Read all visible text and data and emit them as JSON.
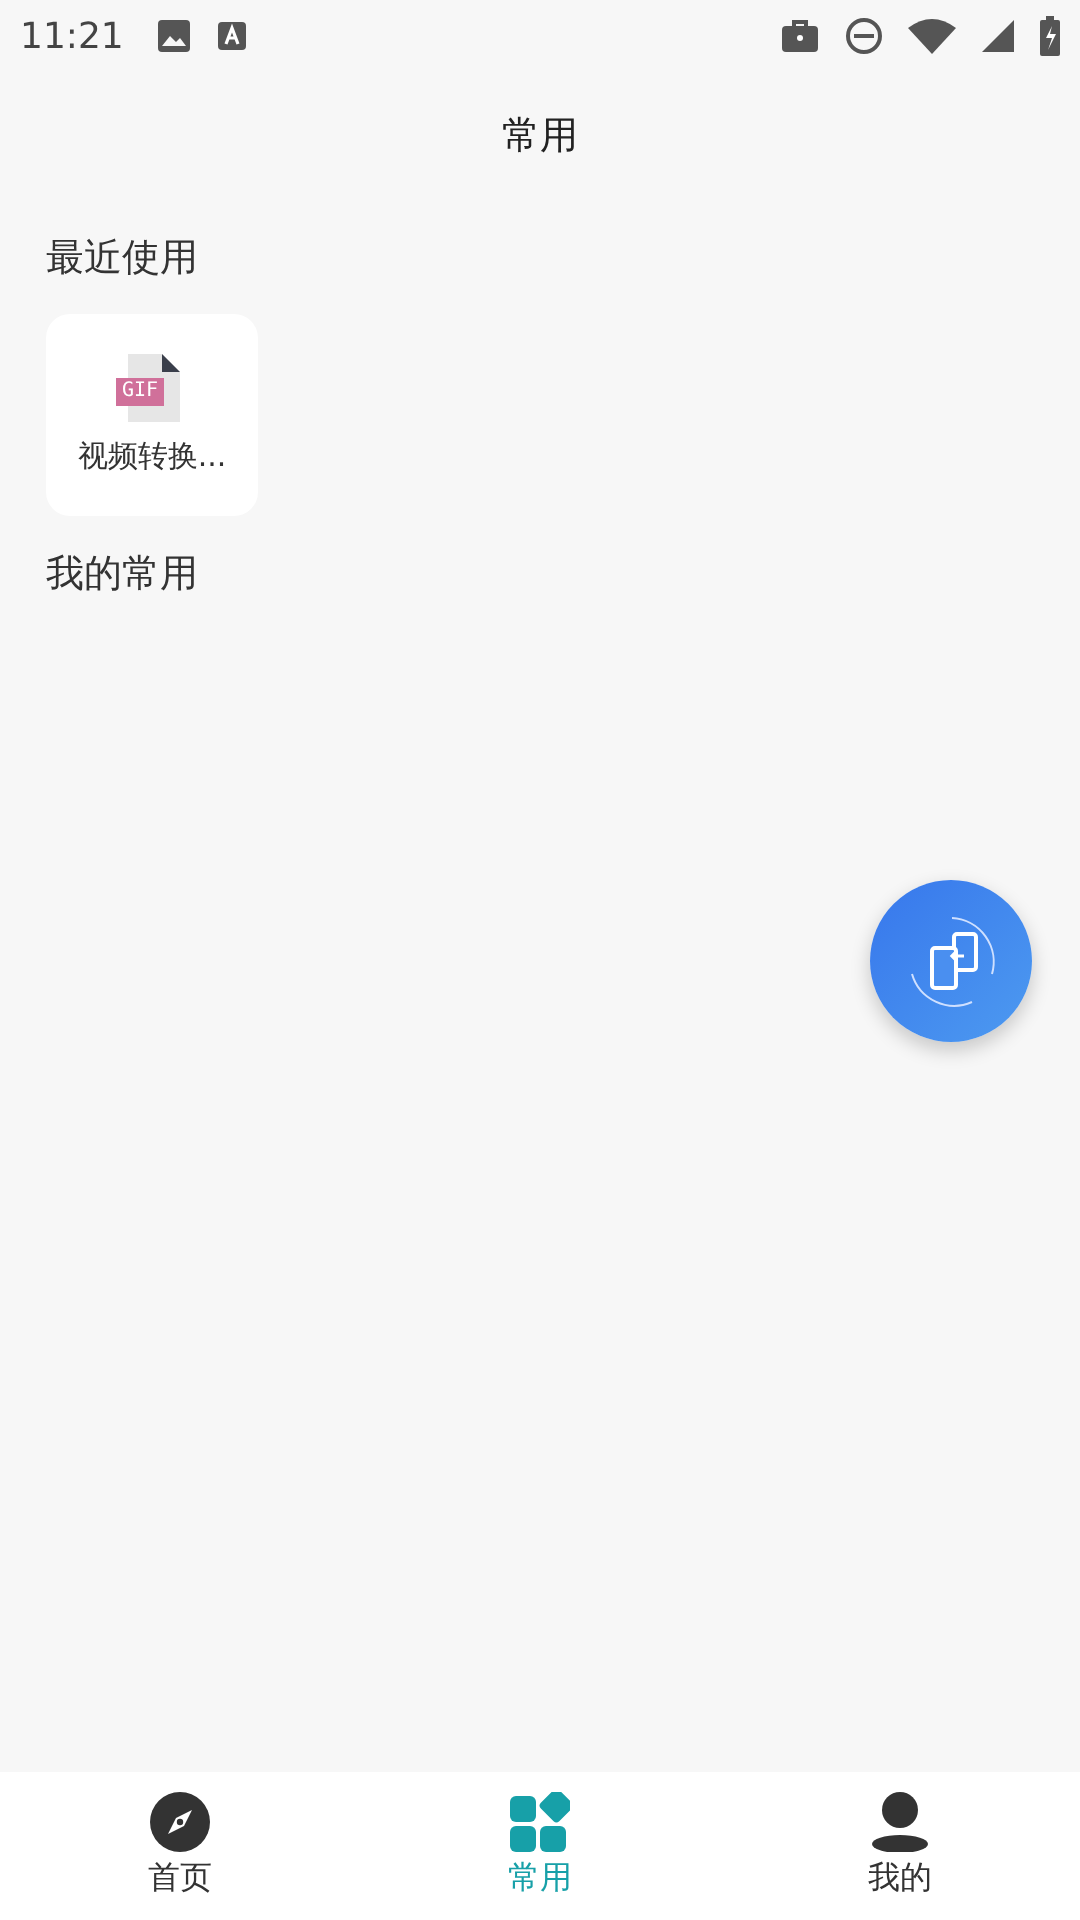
{
  "status_bar": {
    "time": "11:21"
  },
  "header": {
    "title": "常用"
  },
  "recent": {
    "title": "最近使用",
    "items": [
      {
        "badge": "GIF",
        "label": "视频转换..."
      }
    ]
  },
  "favorites": {
    "title": "我的常用"
  },
  "tabs": [
    {
      "kind": "home",
      "label": "首页",
      "selected": false
    },
    {
      "kind": "apps",
      "label": "常用",
      "selected": true
    },
    {
      "kind": "me",
      "label": "我的",
      "selected": false
    }
  ]
}
